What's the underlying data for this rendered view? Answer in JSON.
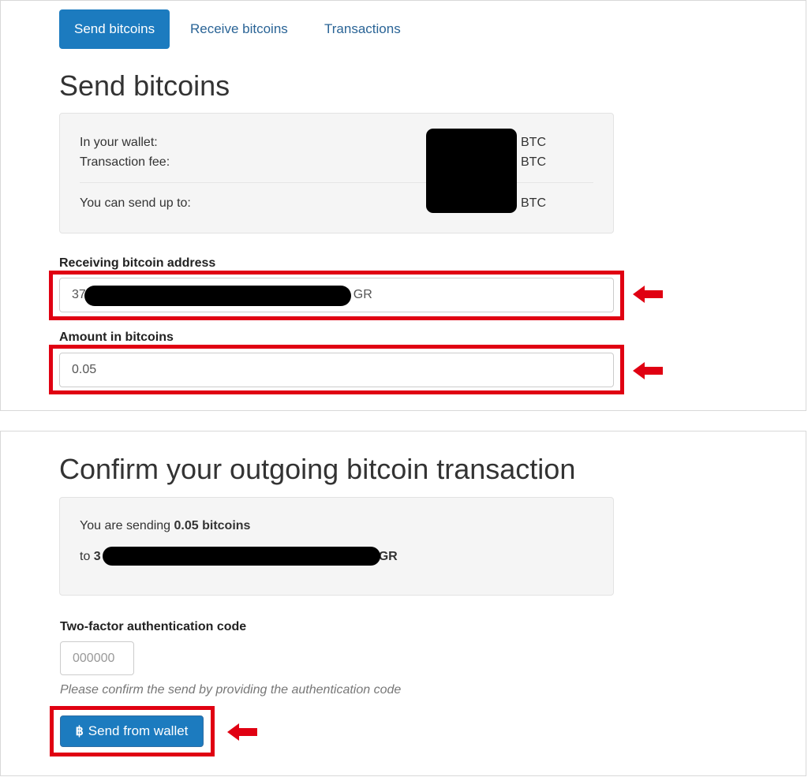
{
  "tabs": [
    "Send bitcoins",
    "Receive bitcoins",
    "Transactions"
  ],
  "send": {
    "title": "Send bitcoins",
    "wallet_label": "In your wallet:",
    "fee_label": "Transaction fee:",
    "sendup_label": "You can send up to:",
    "unit": "BTC",
    "address_label": "Receiving bitcoin address",
    "address_prefix": "37",
    "address_suffix": "GR",
    "amount_label": "Amount in bitcoins",
    "amount_value": "0.05"
  },
  "confirm": {
    "title": "Confirm your outgoing bitcoin transaction",
    "sending_prefix": "You are sending ",
    "sending_amount": "0.05 bitcoins",
    "to_prefix": "to ",
    "to_address_prefix": "3",
    "to_address_suffix": "GR",
    "twofa_label": "Two-factor authentication code",
    "twofa_placeholder": "000000",
    "help_text": "Please confirm the send by providing the authentication code",
    "send_button": "Send from wallet",
    "send_button_icon": "bitcoin-icon"
  },
  "colors": {
    "primary": "#1c7bbf",
    "highlight": "#e00012",
    "redaction": "#000000"
  }
}
